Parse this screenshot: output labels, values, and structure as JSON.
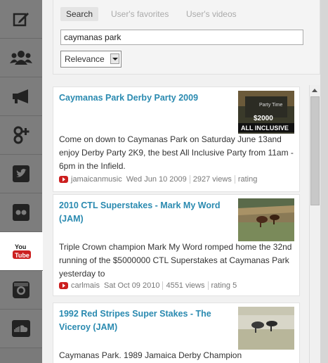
{
  "sidebar": {
    "items": [
      {
        "icon": "edit-icon"
      },
      {
        "icon": "users-icon"
      },
      {
        "icon": "megaphone-icon"
      },
      {
        "icon": "google-plus-icon"
      },
      {
        "icon": "twitter-icon"
      },
      {
        "icon": "flickr-icon"
      },
      {
        "icon": "youtube-icon",
        "active": true,
        "label_top": "You",
        "label_bottom": "Tube"
      },
      {
        "icon": "instagram-icon"
      },
      {
        "icon": "soundcloud-icon"
      }
    ]
  },
  "tabs": [
    {
      "label": "Search",
      "active": true
    },
    {
      "label": "User's favorites"
    },
    {
      "label": "User's videos"
    }
  ],
  "search": {
    "value": "caymanas park"
  },
  "sort": {
    "selected": "Relevance"
  },
  "results": [
    {
      "title": "Caymanas Park Derby Party 2009",
      "description": "Come on down to Caymanas Park on Saturday June 13and enjoy Derby Party 2K9, the best All Inclusive Party from 11am - 6pm in the Infield.",
      "author": "jamaicanmusic",
      "date": "Wed Jun 10 2009",
      "views": "2927 views",
      "rating": "rating",
      "thumb_text_1": "Party Time",
      "thumb_text_2": "$2000",
      "thumb_text_3": "ALL INCLUSIVE"
    },
    {
      "title": "2010 CTL Superstakes - Mark My Word (JAM)",
      "description": "Triple Crown champion Mark My Word romped home the 32nd running of the $5000000 CTL Superstakes at Caymanas Park yesterday to",
      "author": "carlmais",
      "date": "Sat Oct 09 2010",
      "views": "4551 views",
      "rating": "rating 5"
    },
    {
      "title": "1992 Red Stripes Super Stakes - The Viceroy (JAM)",
      "description": "Caymanas Park. 1989 Jamaica Derby Champion"
    }
  ],
  "colors": {
    "accent": "#2a8ab0",
    "sidebar": "#7d7d7d",
    "youtube_red": "#cc1f1f"
  }
}
